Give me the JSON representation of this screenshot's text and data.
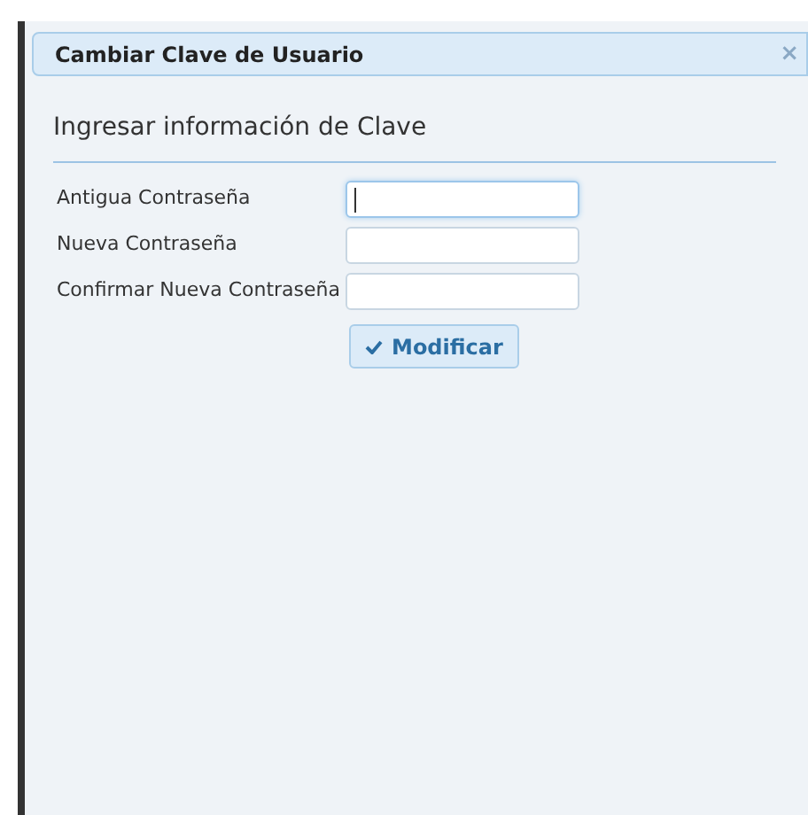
{
  "dialog": {
    "title": "Cambiar Clave de Usuario",
    "close": "×"
  },
  "section": {
    "heading": "Ingresar información de Clave"
  },
  "fields": [
    {
      "label": "Antigua Contraseña",
      "focused": true
    },
    {
      "label": "Nueva Contraseña",
      "focused": false
    },
    {
      "label": "Confirmar Nueva Contraseña",
      "focused": false
    }
  ],
  "submit": {
    "label": "Modificar"
  }
}
